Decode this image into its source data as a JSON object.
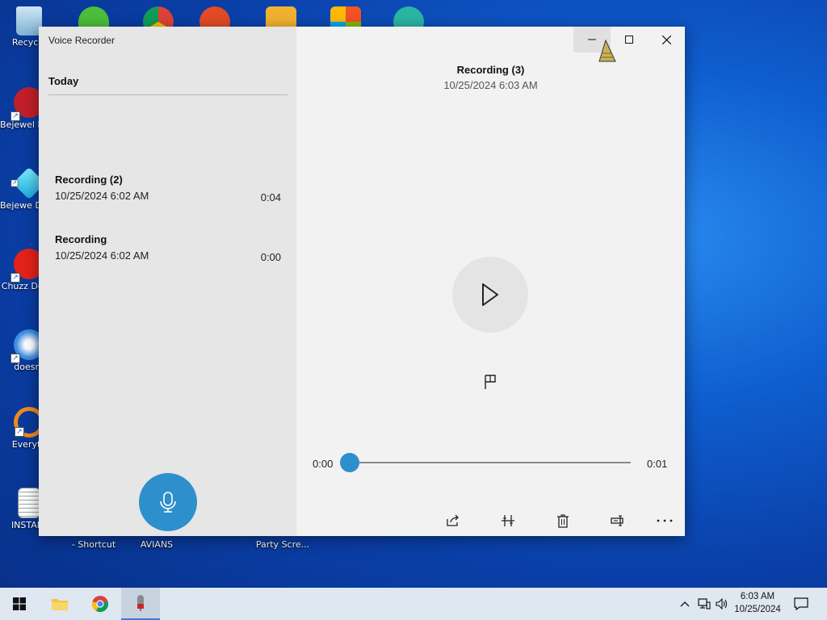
{
  "desktop": {
    "icons": [
      {
        "label": "Recycle"
      },
      {
        "label": "Bejewel Delux"
      },
      {
        "label": "Bejewe Delux"
      },
      {
        "label": "Chuzz Delux"
      },
      {
        "label": "doesnt"
      },
      {
        "label": "Everyth"
      },
      {
        "label": "INSTALL"
      },
      {
        "label": "- Shortcut"
      },
      {
        "label": "AVIANS"
      },
      {
        "label": "Party Scre..."
      }
    ]
  },
  "window": {
    "app_title": "Voice Recorder",
    "controls": {
      "minimize": "minimize-icon",
      "maximize": "maximize-icon",
      "close": "close-icon"
    }
  },
  "recordings": {
    "group_header": "Today",
    "items": [
      {
        "name": "Recording (2)",
        "date": "10/25/2024 6:02 AM",
        "duration": "0:04"
      },
      {
        "name": "Recording",
        "date": "10/25/2024 6:02 AM",
        "duration": "0:00"
      }
    ]
  },
  "player": {
    "title": "Recording (3)",
    "date": "10/25/2024 6:03 AM",
    "time_start": "0:00",
    "time_end": "0:01",
    "progress": 0.0
  },
  "toolbar": {
    "icons": [
      "share-icon",
      "trim-icon",
      "delete-icon",
      "rename-icon",
      "more-icon"
    ]
  },
  "taskbar": {
    "clock_time": "6:03 AM",
    "clock_date": "10/25/2024"
  },
  "colors": {
    "accent": "#2e8fcd",
    "left_pane": "#e6e6e6",
    "right_pane": "#f2f2f2",
    "taskbar": "#dfe7f1"
  }
}
